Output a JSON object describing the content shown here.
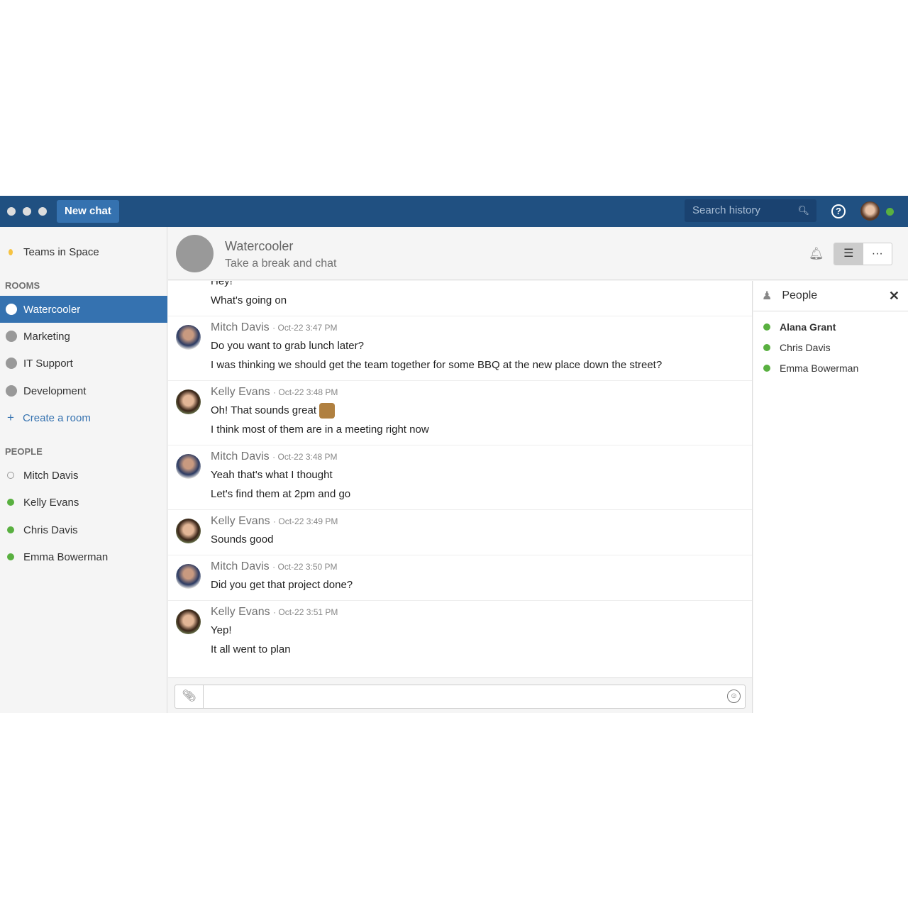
{
  "topbar": {
    "new_chat": "New chat",
    "search_placeholder": "Search history"
  },
  "sidebar": {
    "team": "Teams in Space",
    "rooms_heading": "ROOMS",
    "rooms": [
      "Watercooler",
      "Marketing",
      "IT Support",
      "Development"
    ],
    "create_room": "Create a room",
    "people_heading": "PEOPLE",
    "people": [
      {
        "name": "Mitch Davis",
        "status": "offline"
      },
      {
        "name": "Kelly Evans",
        "status": "online"
      },
      {
        "name": "Chris Davis",
        "status": "online"
      },
      {
        "name": "Emma Bowerman",
        "status": "online"
      }
    ]
  },
  "room": {
    "title": "Watercooler",
    "subtitle": "Take a break and chat"
  },
  "messages": [
    {
      "lines": [
        "Hey!",
        "What's going on"
      ]
    },
    {
      "author": "Mitch Davis",
      "time": "Oct-22 3:47 PM",
      "lines": [
        "Do you want to grab lunch later?",
        "I was thinking we should get the team together for some BBQ at the new place down the street?"
      ]
    },
    {
      "author": "Kelly Evans",
      "time": "Oct-22 3:48 PM",
      "lines": [
        "Oh! That sounds great",
        "I think most of them are in a meeting right now"
      ]
    },
    {
      "author": "Mitch Davis",
      "time": "Oct-22 3:48 PM",
      "lines": [
        "Yeah that's what I thought",
        "Let's find them at 2pm and go"
      ]
    },
    {
      "author": "Kelly Evans",
      "time": "Oct-22 3:49 PM",
      "lines": [
        "Sounds good"
      ]
    },
    {
      "author": "Mitch Davis",
      "time": "Oct-22 3:50 PM",
      "lines": [
        "Did you get that project done?"
      ]
    },
    {
      "author": "Kelly Evans",
      "time": "Oct-22 3:51 PM",
      "lines": [
        "Yep!",
        "It all went to plan"
      ]
    }
  ],
  "people_panel": {
    "title": "People",
    "members": [
      "Alana Grant",
      "Chris Davis",
      "Emma Bowerman"
    ]
  },
  "colors": {
    "topbar": "#205081",
    "accent": "#3572b0",
    "online": "#59b040"
  }
}
